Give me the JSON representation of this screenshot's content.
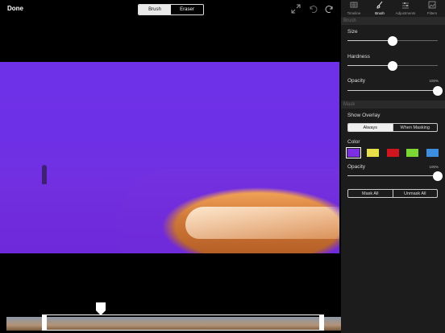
{
  "toolbar": {
    "done_label": "Done",
    "tool_segments": [
      {
        "label": "Brush",
        "selected": true
      },
      {
        "label": "Eraser",
        "selected": false
      }
    ],
    "icons": [
      "fullscreen-icon",
      "undo-icon",
      "redo-icon"
    ]
  },
  "panel": {
    "tabs": [
      {
        "label": "Timeline",
        "icon": "timeline-icon",
        "selected": false
      },
      {
        "label": "Brush",
        "icon": "brush-icon",
        "selected": true
      },
      {
        "label": "Adjustments",
        "icon": "adjustments-icon",
        "selected": false
      },
      {
        "label": "Filters",
        "icon": "filters-icon",
        "selected": false
      }
    ],
    "brush": {
      "header": "Brush",
      "size": {
        "label": "Size",
        "value": 0.5
      },
      "hardness": {
        "label": "Hardness",
        "value": 0.5
      },
      "opacity": {
        "label": "Opacity",
        "value": 1.0,
        "value_text": "100%"
      }
    },
    "mask": {
      "header": "Mask",
      "show_overlay_label": "Show Overlay",
      "overlay_options": [
        {
          "label": "Always",
          "selected": true
        },
        {
          "label": "When Masking",
          "selected": false
        }
      ],
      "color_label": "Color",
      "colors": [
        {
          "hex": "#7b2fe0",
          "selected": true
        },
        {
          "hex": "#e6e04a",
          "selected": false
        },
        {
          "hex": "#d0151f",
          "selected": false
        },
        {
          "hex": "#7cd633",
          "selected": false
        },
        {
          "hex": "#3e8ee0",
          "selected": false
        }
      ],
      "opacity": {
        "label": "Opacity",
        "value": 1.0,
        "value_text": "100%"
      },
      "buttons": [
        {
          "label": "Mask All"
        },
        {
          "label": "Unmask All"
        }
      ]
    }
  },
  "overlay_color": "#6a26e8"
}
